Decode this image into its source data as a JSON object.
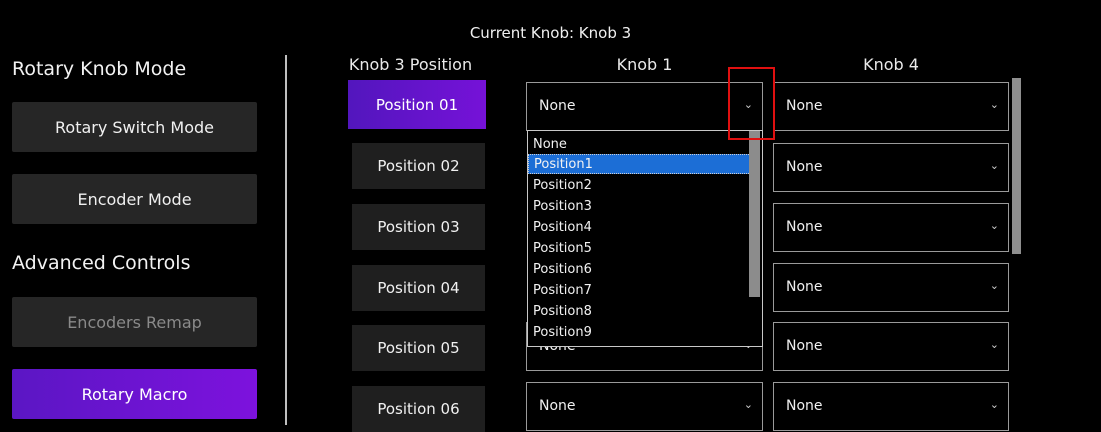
{
  "header": {
    "current_knob": "Current Knob: Knob 3"
  },
  "left": {
    "rotary_title": "Rotary Knob Mode",
    "rotary_switch": "Rotary Switch Mode",
    "encoder_mode": "Encoder Mode",
    "advanced_title": "Advanced Controls",
    "encoders_remap": "Encoders Remap",
    "rotary_macro": "Rotary Macro"
  },
  "table": {
    "col_position": "Knob 3 Position",
    "col_knob1": "Knob 1",
    "col_knob4": "Knob 4",
    "rows": [
      {
        "label": "Position 01",
        "knob1": "None",
        "knob4": "None"
      },
      {
        "label": "Position 02",
        "knob1": "",
        "knob4": "None"
      },
      {
        "label": "Position 03",
        "knob1": "",
        "knob4": "None"
      },
      {
        "label": "Position 04",
        "knob1": "",
        "knob4": "None"
      },
      {
        "label": "Position 05",
        "knob1": "None",
        "knob4": "None"
      },
      {
        "label": "Position 06",
        "knob1": "None",
        "knob4": "None"
      }
    ]
  },
  "dropdown": {
    "options": [
      "None",
      "Position1",
      "Position2",
      "Position3",
      "Position4",
      "Position5",
      "Position6",
      "Position7",
      "Position8",
      "Position9"
    ],
    "highlighted": "Position1"
  },
  "colors": {
    "accent_purple": "#6a14d0",
    "highlight_blue": "#1c6ed6",
    "annotation_red": "#e01010"
  },
  "icons": {
    "chevron": "chevron-down-icon"
  }
}
